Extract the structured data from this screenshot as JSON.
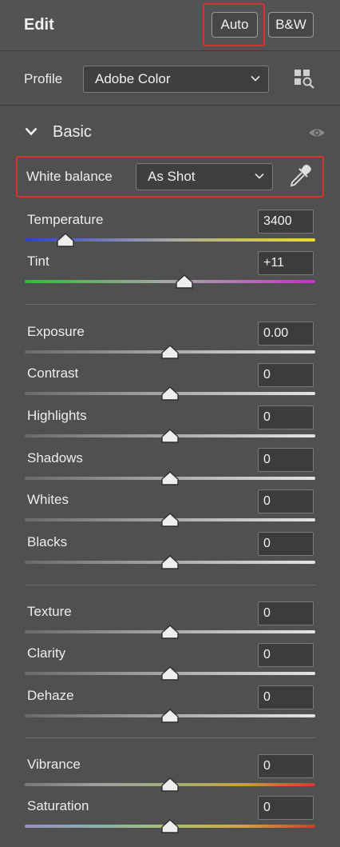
{
  "header": {
    "title": "Edit",
    "auto_label": "Auto",
    "bw_label": "B&W"
  },
  "profile": {
    "label": "Profile",
    "value": "Adobe Color",
    "browser_icon": "grid-search-icon"
  },
  "basic": {
    "title": "Basic",
    "visibility_icon": "eye-icon",
    "white_balance": {
      "label": "White balance",
      "value": "As Shot",
      "picker_icon": "eyedropper-icon"
    },
    "sliders": [
      {
        "label": "Temperature",
        "value": "3400",
        "position": 0.14
      },
      {
        "label": "Tint",
        "value": "+11",
        "position": 0.55
      },
      {
        "label": "Exposure",
        "value": "0.00",
        "position": 0.5
      },
      {
        "label": "Contrast",
        "value": "0",
        "position": 0.5
      },
      {
        "label": "Highlights",
        "value": "0",
        "position": 0.5
      },
      {
        "label": "Shadows",
        "value": "0",
        "position": 0.5
      },
      {
        "label": "Whites",
        "value": "0",
        "position": 0.5
      },
      {
        "label": "Blacks",
        "value": "0",
        "position": 0.5
      },
      {
        "label": "Texture",
        "value": "0",
        "position": 0.5
      },
      {
        "label": "Clarity",
        "value": "0",
        "position": 0.5
      },
      {
        "label": "Dehaze",
        "value": "0",
        "position": 0.5
      },
      {
        "label": "Vibrance",
        "value": "0",
        "position": 0.5
      },
      {
        "label": "Saturation",
        "value": "0",
        "position": 0.5
      }
    ]
  },
  "colors": {
    "highlight": "#d8332a",
    "background": "#505050"
  }
}
